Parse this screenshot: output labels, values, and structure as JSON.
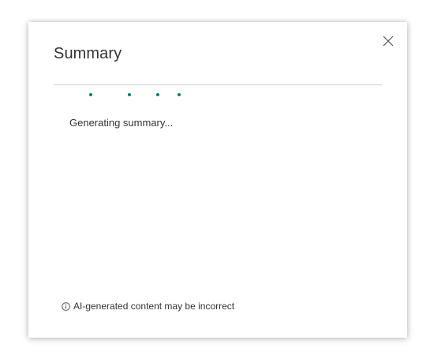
{
  "dialog": {
    "title": "Summary",
    "close_icon": "close-icon",
    "status_text": "Generating summary...",
    "disclaimer_icon": "info-icon",
    "disclaimer_text": "AI-generated content may be incorrect"
  },
  "colors": {
    "progress_dot": "#107c70",
    "text": "#333333",
    "divider": "#cfcfcf"
  }
}
